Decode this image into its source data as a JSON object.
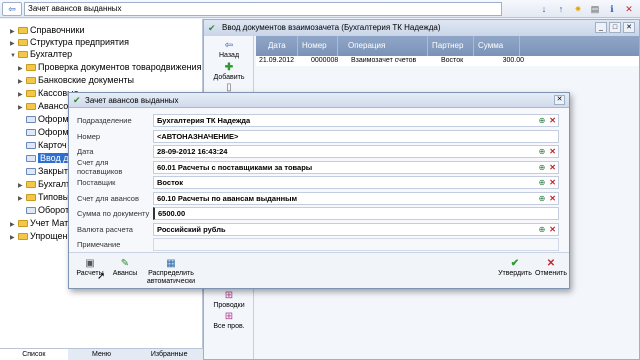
{
  "topbar": {
    "title": "Зачет авансов выданных",
    "icons": [
      "back-arrow-icon",
      "down-arrow-icon",
      "up-arrow-icon",
      "star-icon",
      "print-icon",
      "info-icon",
      "close-icon"
    ]
  },
  "tree": {
    "items": [
      {
        "label": "Справочники",
        "expander": "▶"
      },
      {
        "label": "Структура предприятия",
        "expander": "▶"
      },
      {
        "label": "Бухгалтер",
        "expander": "▼"
      },
      {
        "label": "Проверка документов товародвижения",
        "expander": "▶"
      },
      {
        "label": "Банковские документы",
        "expander": "▶"
      },
      {
        "label": "Кассовые",
        "expander": "▶"
      },
      {
        "label": "Авансов",
        "expander": "▶"
      },
      {
        "label": "Оформ",
        "expander": ""
      },
      {
        "label": "Оформ",
        "expander": ""
      },
      {
        "label": "Карточ",
        "expander": ""
      },
      {
        "label": "Ввод до",
        "expander": ""
      },
      {
        "label": "Закрыт",
        "expander": ""
      },
      {
        "label": "Бухгалт",
        "expander": "▶"
      },
      {
        "label": "Типовы",
        "expander": "▶"
      },
      {
        "label": "Оборот",
        "expander": ""
      },
      {
        "label": "Учет Мате",
        "expander": "▶"
      },
      {
        "label": "Упрощенн",
        "expander": "▶"
      }
    ],
    "bottom_tabs": [
      "Список",
      "Меню",
      "Избранные"
    ]
  },
  "bgwindow": {
    "title": "Ввод документов взаимозачета (Бухгалтерия ТК Надежда)",
    "sidebar": {
      "back": "Назад",
      "add": "Добавить",
      "postings": "Проводки",
      "all_postings": "Все пров."
    },
    "columns": [
      "Дата",
      "Номер",
      "Операция",
      "Партнер",
      "Сумма"
    ],
    "rows": [
      {
        "date": "21.09.2012",
        "number": "0000008",
        "operation": "Взаимозачет счетов",
        "partner": "Восток",
        "sum": "300.00"
      }
    ]
  },
  "dialog": {
    "title": "Зачет авансов выданных",
    "fields": [
      {
        "label": "Подразделение",
        "value": "Бухгалтерия ТК Надежда",
        "actions": true
      },
      {
        "label": "Номер",
        "value": "<АВТОНАЗНАЧЕНИЕ>",
        "actions": false
      },
      {
        "label": "Дата",
        "value": "28-09-2012 16:43:24",
        "actions": true
      },
      {
        "label": "Счет для поставщиков",
        "value": "60.01 Расчеты с поставщиками за товары",
        "actions": true
      },
      {
        "label": "Поставщик",
        "value": "Восток",
        "actions": true
      },
      {
        "label": "Счет для авансов",
        "value": "60.10 Расчеты по авансам выданным",
        "actions": true
      },
      {
        "label": "Сумма по документу",
        "value": "6500.00",
        "actions": false
      },
      {
        "label": "Валюта расчета",
        "value": "Российский рубль",
        "actions": true
      },
      {
        "label": "Примечание",
        "value": "",
        "actions": false
      }
    ],
    "toolbar": {
      "payments": "Расчеты",
      "advances": "Авансы",
      "distribute_line1": "Распределить",
      "distribute_line2": "автоматически",
      "approve": "Утвердить",
      "cancel": "Отменить"
    }
  }
}
